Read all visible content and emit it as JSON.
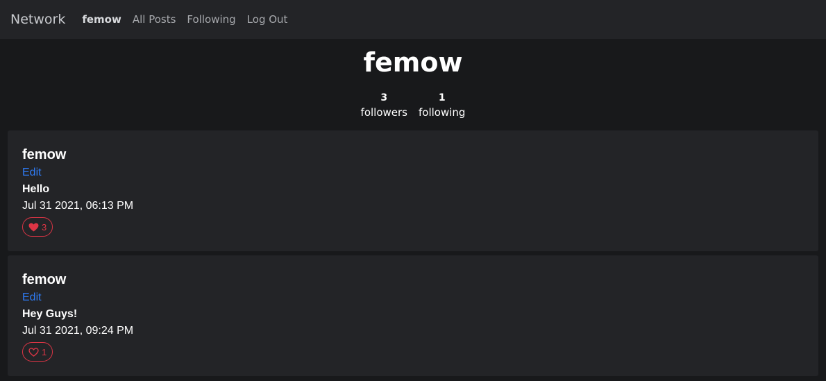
{
  "navbar": {
    "brand": "Network",
    "links": [
      {
        "label": "femow",
        "active": true
      },
      {
        "label": "All Posts"
      },
      {
        "label": "Following"
      },
      {
        "label": "Log Out"
      }
    ]
  },
  "profile": {
    "username": "femow",
    "followers_count": "3",
    "followers_label": "followers",
    "following_count": "1",
    "following_label": "following"
  },
  "posts": [
    {
      "author": "femow",
      "edit_label": "Edit",
      "content": "Hello",
      "timestamp": "Jul 31 2021, 06:13 PM",
      "likes": "3",
      "liked": true,
      "like_icon": "heart-filled-icon"
    },
    {
      "author": "femow",
      "edit_label": "Edit",
      "content": "Hey Guys!",
      "timestamp": "Jul 31 2021, 09:24 PM",
      "likes": "1",
      "liked": false,
      "like_icon": "heart-outline-icon"
    }
  ],
  "colors": {
    "background": "#18191b",
    "surface": "#232427",
    "link": "#2f7cf6",
    "like": "#dc3545"
  }
}
